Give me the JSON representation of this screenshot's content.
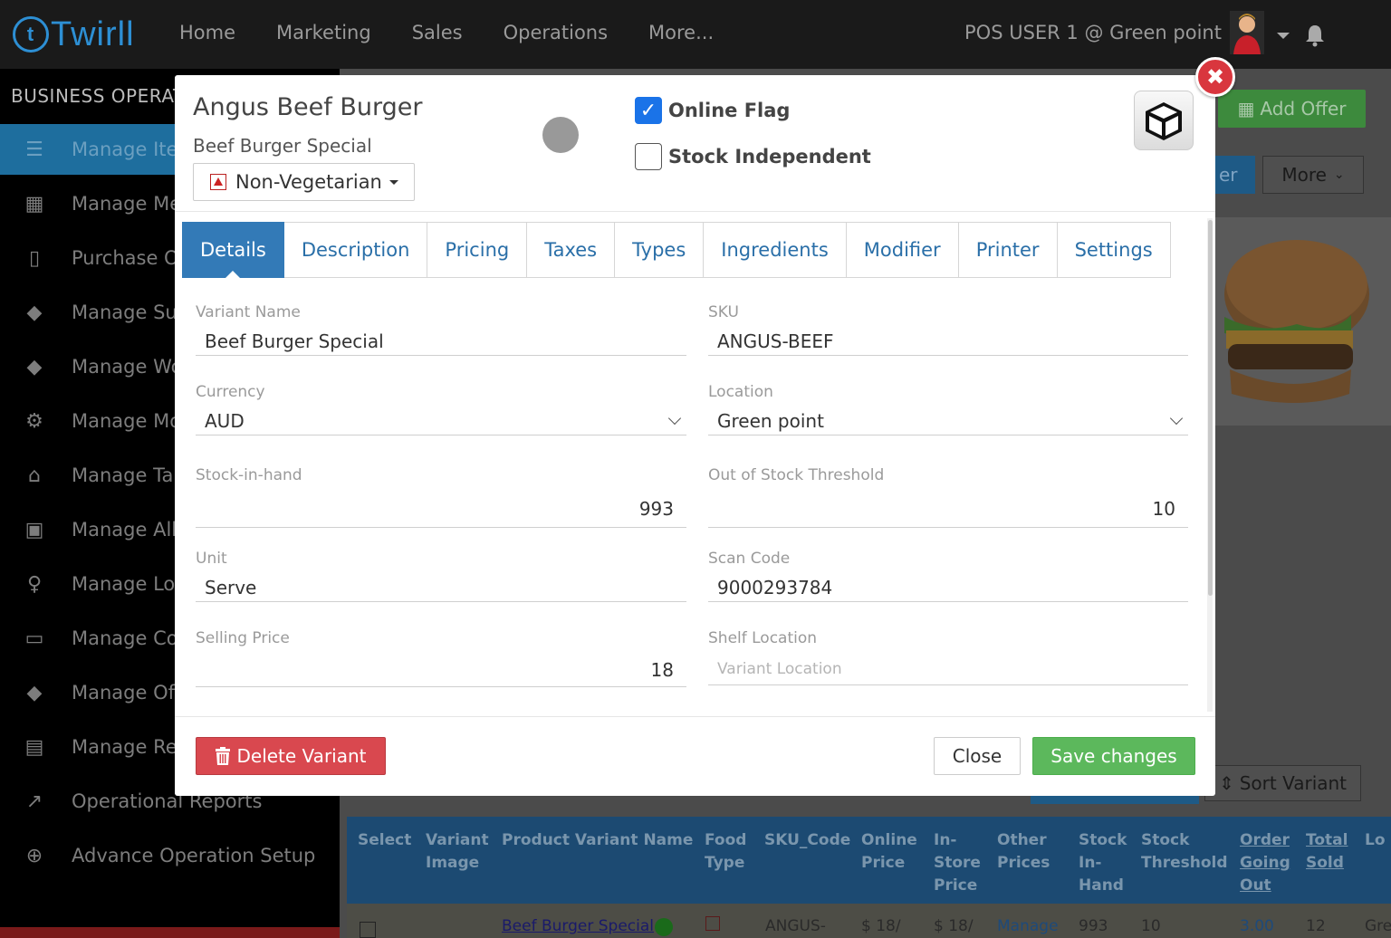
{
  "topbar": {
    "logo": "Twirll",
    "nav": [
      "Home",
      "Marketing",
      "Sales",
      "Operations",
      "More..."
    ],
    "user": "POS USER 1 @ Green point"
  },
  "sidebar": {
    "heading": "BUSINESS OPERAT",
    "items": [
      {
        "label": "Manage Ite",
        "icon": "list-icon"
      },
      {
        "label": "Manage Me",
        "icon": "grid-icon"
      },
      {
        "label": "Purchase O",
        "icon": "document-icon"
      },
      {
        "label": "Manage Su",
        "icon": "tags-icon"
      },
      {
        "label": "Manage Wo",
        "icon": "tags-icon"
      },
      {
        "label": "Manage Mo",
        "icon": "gears-icon"
      },
      {
        "label": "Manage Ta",
        "icon": "bank-icon"
      },
      {
        "label": "Manage All",
        "icon": "image-icon"
      },
      {
        "label": "Manage Lo",
        "icon": "loyalty-icon"
      },
      {
        "label": "Manage Co",
        "icon": "ticket-icon"
      },
      {
        "label": "Manage Of",
        "icon": "tags-icon"
      },
      {
        "label": "Manage Re",
        "icon": "contact-icon"
      },
      {
        "label": "Operational Reports",
        "icon": "chart-icon"
      },
      {
        "label": "Advance Operation Setup",
        "icon": "plus-circle-icon"
      }
    ]
  },
  "background": {
    "add_offer": "Add Offer",
    "partial_btn": "er",
    "more": "More",
    "sort_variant": "Sort Variant",
    "table_headers": [
      "Select",
      "Variant Image",
      "Product Variant Name",
      "Food Type",
      "SKU_Code",
      "Online Price",
      "In-Store Price",
      "Other Prices",
      "Stock In-Hand",
      "Stock Threshold",
      "Order Going Out",
      "Total Sold",
      "Lo"
    ],
    "row": {
      "name": "Beef Burger Special",
      "sku": "ANGUS-",
      "online_price": "$ 18/",
      "instore_price": "$ 18/",
      "other": "Manage",
      "stock": "993",
      "threshold": "10",
      "order_out": "3.00",
      "total_sold": "12",
      "loc": "Gre"
    }
  },
  "modal": {
    "title": "Angus Beef Burger",
    "subtitle": "Beef Burger Special",
    "food_type": "Non-Vegetarian",
    "online_flag": {
      "label": "Online Flag",
      "checked": true
    },
    "stock_independent": {
      "label": "Stock Independent",
      "checked": false
    },
    "tabs": [
      "Details",
      "Description",
      "Pricing",
      "Taxes",
      "Types",
      "Ingredients",
      "Modifier",
      "Printer",
      "Settings"
    ],
    "active_tab": "Details",
    "fields": {
      "variant_name": {
        "label": "Variant Name",
        "value": "Beef Burger Special"
      },
      "sku": {
        "label": "SKU",
        "value": "ANGUS-BEEF"
      },
      "currency": {
        "label": "Currency",
        "value": "AUD"
      },
      "location": {
        "label": "Location",
        "value": "Green point"
      },
      "stock_in_hand": {
        "label": "Stock-in-hand",
        "value": "993"
      },
      "oos_threshold": {
        "label": "Out of Stock Threshold",
        "value": "10"
      },
      "unit": {
        "label": "Unit",
        "value": "Serve"
      },
      "scan_code": {
        "label": "Scan Code",
        "value": "9000293784"
      },
      "selling_price": {
        "label": "Selling Price",
        "value": "18"
      },
      "shelf_location": {
        "label": "Shelf Location",
        "placeholder": "Variant Location"
      }
    },
    "buttons": {
      "delete": "Delete Variant",
      "close": "Close",
      "save": "Save changes"
    }
  },
  "colors": {
    "primary": "#337ab7",
    "success": "#5cb85c",
    "danger": "#d9484f",
    "checkbox": "#1a73e8"
  }
}
